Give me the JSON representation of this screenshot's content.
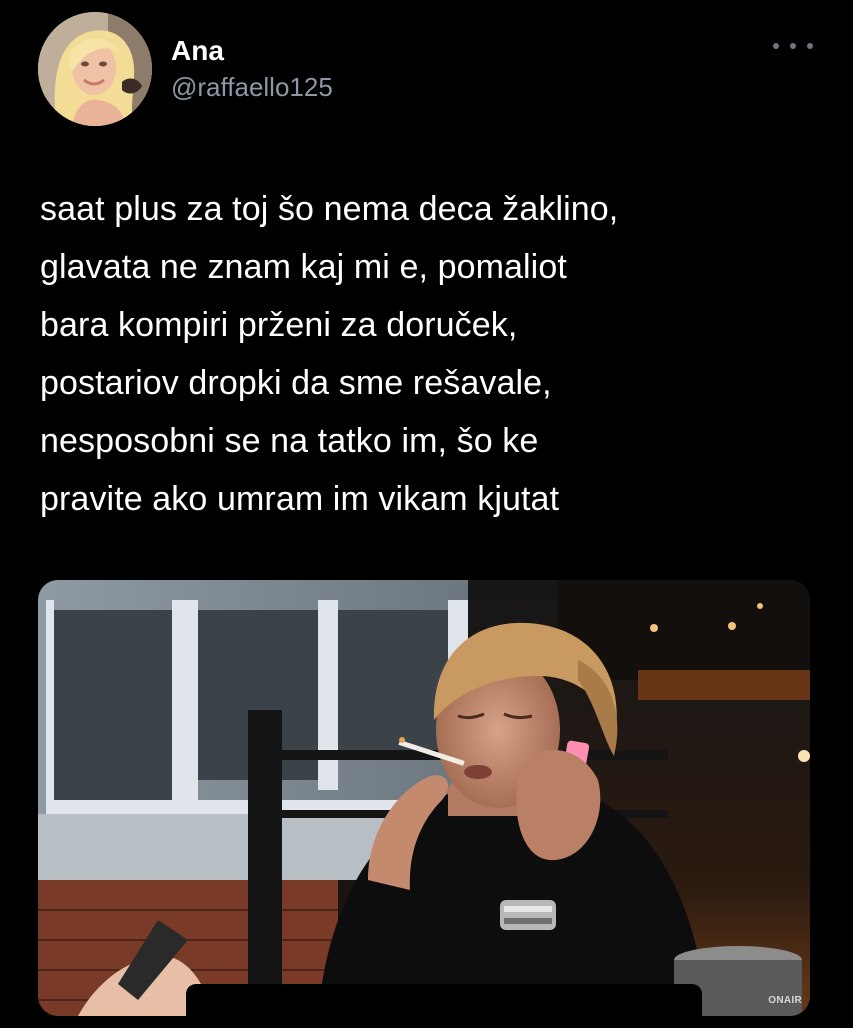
{
  "author": {
    "display_name": "Ana",
    "handle": "@raffaello125",
    "avatar_icon": "profile-photo"
  },
  "more_icon": "ellipsis-icon",
  "tweet": {
    "lines": [
      "saat plus za toj šo nema deca žaklino,",
      "glavata ne znam kaj mi e, pomaliot",
      "bara kompiri prženi za doruček,",
      "postariov dropki da sme rešavale,",
      "nesposobni se na tatko im, šo ke",
      "pravite ako umram im vikam kjutat"
    ]
  },
  "media": {
    "watermark": "ONAIR",
    "description_icon": "photo-image"
  },
  "colors": {
    "background": "#000000",
    "text": "#ffffff",
    "secondary": "#8b98a5"
  }
}
